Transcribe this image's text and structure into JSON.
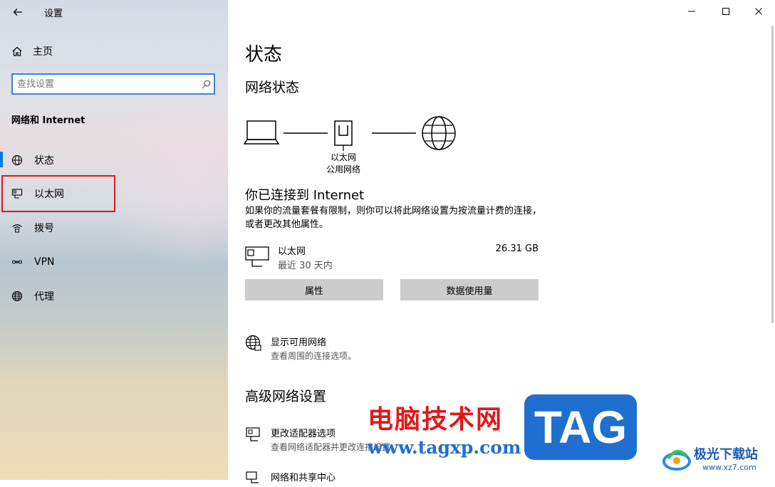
{
  "window": {
    "title": "设置"
  },
  "sidebar": {
    "home_label": "主页",
    "search_placeholder": "查找设置",
    "section_title": "网络和 Internet",
    "items": [
      {
        "label": "状态",
        "icon": "globe-status-icon"
      },
      {
        "label": "以太网",
        "icon": "ethernet-icon"
      },
      {
        "label": "拨号",
        "icon": "dialup-icon"
      },
      {
        "label": "VPN",
        "icon": "vpn-icon"
      },
      {
        "label": "代理",
        "icon": "proxy-globe-icon"
      }
    ],
    "active_index": 0,
    "highlighted_index": 1
  },
  "main": {
    "title": "状态",
    "network_status_heading": "网络状态",
    "diagram": {
      "node_label_1": "以太网",
      "node_label_2": "公用网络"
    },
    "connected_title": "你已连接到 Internet",
    "connected_desc": "如果你的流量套餐有限制，则你可以将此网络设置为按流量计费的连接，或者更改其他属性。",
    "adapter": {
      "name": "以太网",
      "period": "最近 30 天内",
      "usage": "26.31 GB"
    },
    "buttons": {
      "properties": "属性",
      "data_usage": "数据使用量"
    },
    "show_networks": {
      "title": "显示可用网络",
      "subtitle": "查看周围的连接选项。"
    },
    "advanced_heading": "高级网络设置",
    "adapter_options": {
      "title": "更改适配器选项",
      "subtitle": "查看网络适配器并更改连接设置。"
    },
    "sharing_center": {
      "title": "网络和共享中心"
    }
  },
  "watermark": {
    "site_cn": "电脑技术网",
    "site_url": "www.tagxp.com",
    "tag": "TAG",
    "logo_cn": "极光下载站",
    "logo_url": "www.xz7.com"
  },
  "colors": {
    "accent": "#0078d7",
    "highlight": "#e0171c",
    "button": "#cccccc"
  }
}
